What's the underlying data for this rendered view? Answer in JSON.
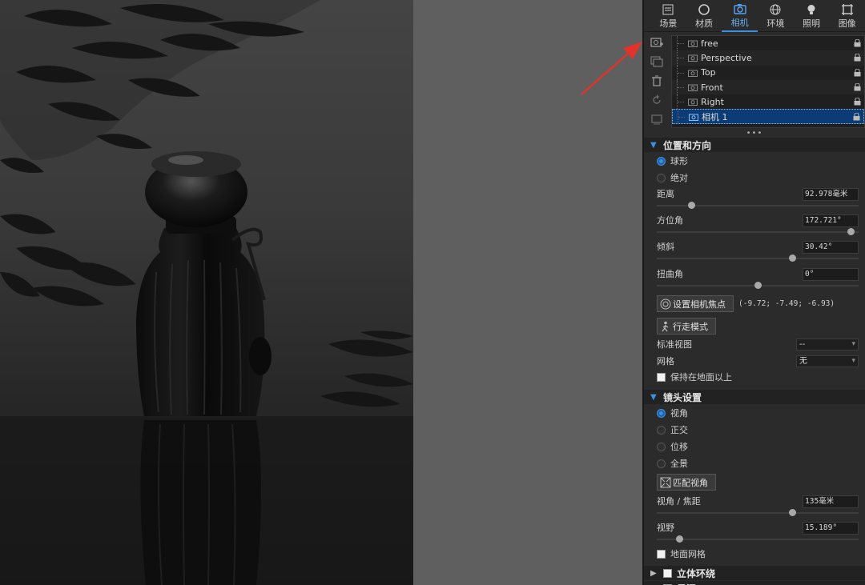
{
  "tabs": [
    {
      "label": "场景",
      "icon": "scene-icon"
    },
    {
      "label": "材质",
      "icon": "material-icon"
    },
    {
      "label": "相机",
      "icon": "camera-icon",
      "active": true
    },
    {
      "label": "环境",
      "icon": "environment-icon"
    },
    {
      "label": "照明",
      "icon": "lighting-icon"
    },
    {
      "label": "图像",
      "icon": "image-icon"
    }
  ],
  "side_tools": [
    "add-camera-icon",
    "duplicate-camera-icon",
    "delete-icon",
    "reset-icon",
    "save-view-icon"
  ],
  "cameras": [
    "free",
    "Perspective",
    "Top",
    "Front",
    "Right",
    "相机 1"
  ],
  "selected_camera": "相机 1",
  "more_dots": "•••",
  "position": {
    "header": "位置和方向",
    "radio_spherical": "球形",
    "radio_absolute": "绝对",
    "distance_label": "距离",
    "distance_value": "92.978毫米",
    "distance_slider": 0.17,
    "azimuth_label": "方位角",
    "azimuth_value": "172.721°",
    "azimuth_slider": 0.96,
    "tilt_label": "倾斜",
    "tilt_value": "30.42°",
    "tilt_slider": 0.67,
    "twist_label": "扭曲角",
    "twist_value": "0°",
    "twist_slider": 0.5,
    "focus_button": "设置相机焦点",
    "focus_coords": "(-9.72; -7.49; -6.93)",
    "walk_button": "行走模式",
    "std_view_label": "标准视图",
    "std_view_value": "--",
    "grid_label": "网格",
    "grid_value": "无",
    "keep_above_ground": "保持在地面以上"
  },
  "lens": {
    "header": "镜头设置",
    "radio_fov": "视角",
    "radio_ortho": "正交",
    "radio_shift": "位移",
    "radio_panorama": "全景",
    "match_button": "匹配视角",
    "focal_label": "视角 / 焦距",
    "focal_value": "135毫米",
    "focal_slider": 0.67,
    "fov_label": "视野",
    "fov_value": "15.189°",
    "fov_slider": 0.11,
    "ground_grid": "地面网格"
  },
  "stereo": {
    "header": "立体环绕"
  },
  "next_section": {
    "header": "景深"
  }
}
